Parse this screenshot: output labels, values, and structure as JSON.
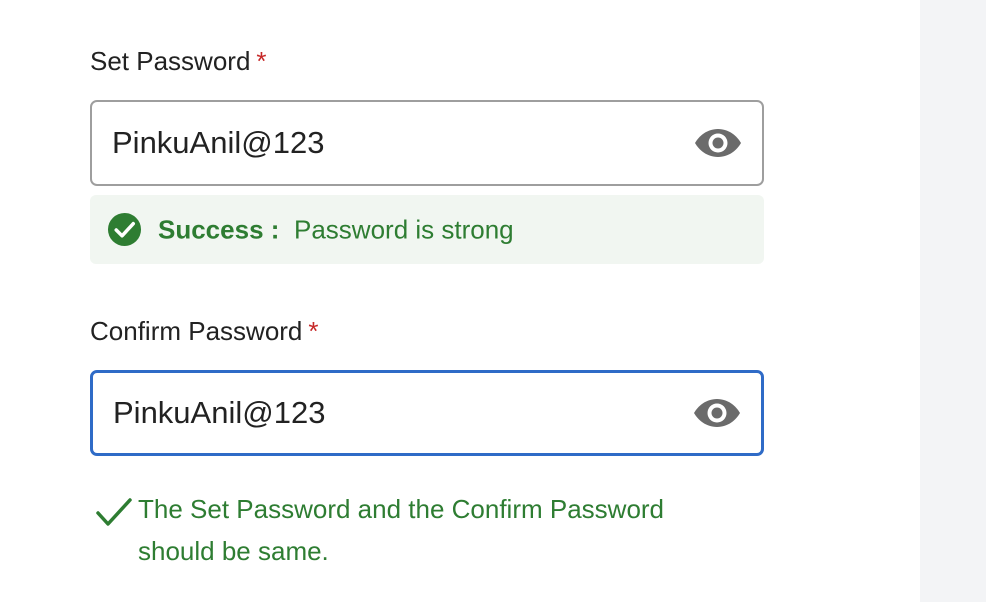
{
  "set_password": {
    "label": "Set Password",
    "required_mark": "*",
    "value": "PinkuAnil@123",
    "toggle_icon": "eye-icon"
  },
  "strength_message": {
    "status_icon": "check-circle-icon",
    "status_label": "Success :",
    "message": "Password is strong"
  },
  "confirm_password": {
    "label": "Confirm Password",
    "required_mark": "*",
    "value": "PinkuAnil@123",
    "toggle_icon": "eye-icon"
  },
  "match_message": {
    "icon": "checkmark-icon",
    "text": "The Set Password and the Confirm Password should be same."
  },
  "colors": {
    "success_green": "#2e7d32",
    "required_red": "#c62828",
    "focus_blue": "#2f6bc7",
    "success_bg": "#f1f6f1"
  }
}
